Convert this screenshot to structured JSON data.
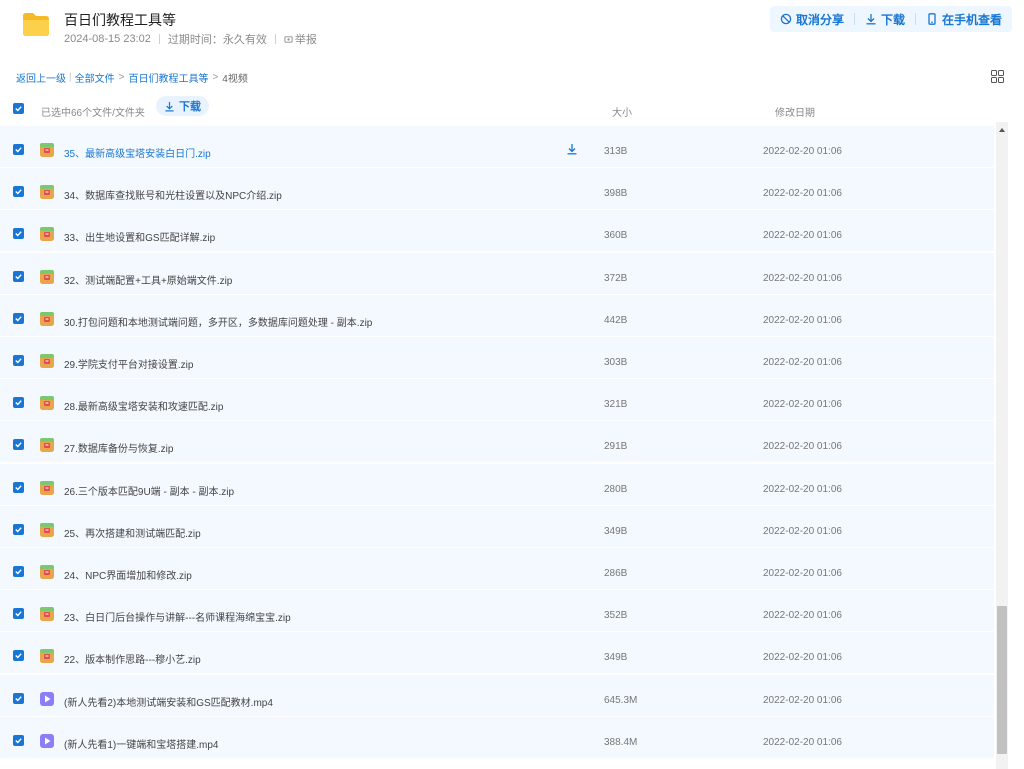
{
  "header": {
    "title": "百日们教程工具等",
    "date": "2024-08-15 23:02",
    "expiry": "过期时间：永久有效",
    "report": "举报",
    "actions": {
      "cancel_share": "取消分享",
      "download": "下载",
      "open_phone": "在手机查看"
    }
  },
  "breadcrumb": {
    "back": "返回上一级",
    "all_files": "全部文件",
    "folder": "百日们教程工具等",
    "current": "4视频"
  },
  "list_header": {
    "selected": "已选中66个文件/文件夹",
    "download": "下载",
    "size": "大小",
    "date": "修改日期"
  },
  "files": [
    {
      "name": "35、最新高级宝塔安装白日门.zip",
      "size": "313B",
      "date": "2022-02-20 01:06",
      "type": "zip"
    },
    {
      "name": "34、数据库查找账号和光柱设置以及NPC介绍.zip",
      "size": "398B",
      "date": "2022-02-20 01:06",
      "type": "zip"
    },
    {
      "name": "33、出生地设置和GS匹配详解.zip",
      "size": "360B",
      "date": "2022-02-20 01:06",
      "type": "zip"
    },
    {
      "name": "32、测试端配置+工具+原始端文件.zip",
      "size": "372B",
      "date": "2022-02-20 01:06",
      "type": "zip"
    },
    {
      "name": "30.打包问题和本地测试端问题，多开区，多数据库问题处理 - 副本.zip",
      "size": "442B",
      "date": "2022-02-20 01:06",
      "type": "zip"
    },
    {
      "name": "29.学院支付平台对接设置.zip",
      "size": "303B",
      "date": "2022-02-20 01:06",
      "type": "zip"
    },
    {
      "name": "28.最新高级宝塔安装和攻速匹配.zip",
      "size": "321B",
      "date": "2022-02-20 01:06",
      "type": "zip"
    },
    {
      "name": "27.数据库备份与恢复.zip",
      "size": "291B",
      "date": "2022-02-20 01:06",
      "type": "zip"
    },
    {
      "name": "26.三个版本匹配9U端 - 副本 - 副本.zip",
      "size": "280B",
      "date": "2022-02-20 01:06",
      "type": "zip"
    },
    {
      "name": "25、再次搭建和测试端匹配.zip",
      "size": "349B",
      "date": "2022-02-20 01:06",
      "type": "zip"
    },
    {
      "name": "24、NPC界面增加和修改.zip",
      "size": "286B",
      "date": "2022-02-20 01:06",
      "type": "zip"
    },
    {
      "name": "23、白日门后台操作与讲解---名师课程海绵宝宝.zip",
      "size": "352B",
      "date": "2022-02-20 01:06",
      "type": "zip"
    },
    {
      "name": "22、版本制作思路---穆小艺.zip",
      "size": "349B",
      "date": "2022-02-20 01:06",
      "type": "zip"
    },
    {
      "name": "(新人先看2)本地测试端安装和GS匹配教材.mp4",
      "size": "645.3M",
      "date": "2022-02-20 01:06",
      "type": "video"
    },
    {
      "name": "(新人先看1)一键端和宝塔搭建.mp4",
      "size": "388.4M",
      "date": "2022-02-20 01:06",
      "type": "video"
    }
  ],
  "colors": {
    "accent": "#1976d2",
    "row_bg": "#f3f9ff",
    "folder": "#f9c33a"
  }
}
